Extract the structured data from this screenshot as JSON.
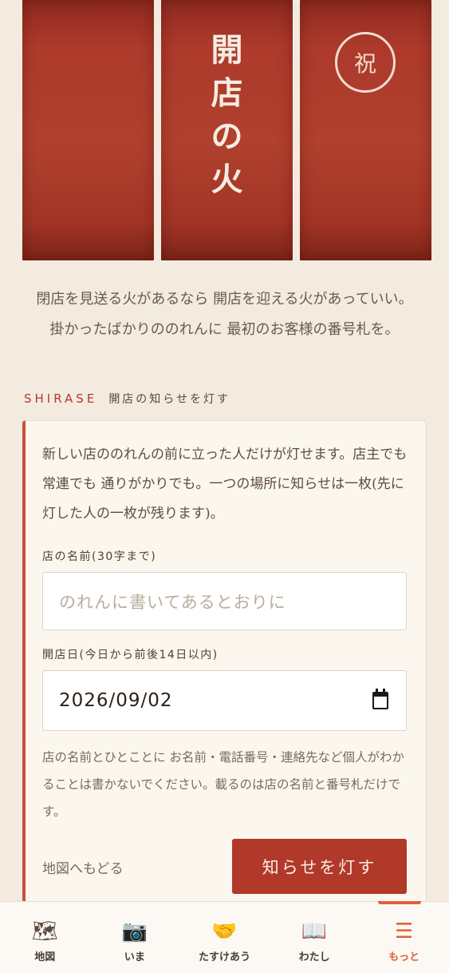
{
  "noren": {
    "title_chars": [
      "開",
      "店",
      "の",
      "火"
    ],
    "seal": "祝"
  },
  "intro": {
    "line1": "閉店を見送る火があるなら 開店を迎える火があっていい。",
    "line2": "掛かったばかりののれんに 最初のお客様の番号札を。"
  },
  "section": {
    "en": "SHIRASE",
    "ja": "開店の知らせを灯す"
  },
  "form": {
    "description": "新しい店ののれんの前に立った人だけが灯せます。店主でも 常連でも 通りがかりでも。一つの場所に知らせは一枚(先に灯した人の一枚が残ります)。",
    "name_label": "店の名前(30字まで)",
    "name_placeholder": "のれんに書いてあるとおりに",
    "date_label": "開店日(今日から前後14日以内)",
    "date_value": "2026/09/02",
    "note": "店の名前とひとことに お名前・電話番号・連絡先など個人がわかることは書かないでください。載るのは店の名前と番号札だけです。",
    "back_link": "地図へもどる",
    "submit": "知らせを灯す"
  },
  "nav": {
    "items": [
      {
        "icon": "🗺",
        "label": "地図"
      },
      {
        "icon": "📷",
        "label": "いま"
      },
      {
        "icon": "🤝",
        "label": "たすけあう"
      },
      {
        "icon": "📖",
        "label": "わたし"
      },
      {
        "icon": "☰",
        "label": "もっと"
      }
    ],
    "active_index": 4
  }
}
